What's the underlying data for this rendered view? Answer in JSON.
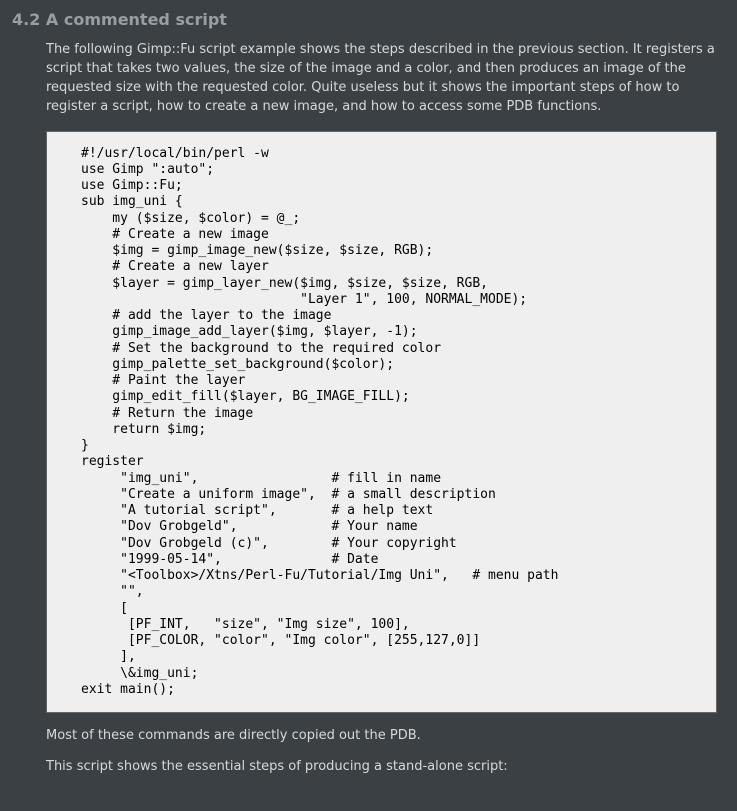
{
  "heading": "4.2 A commented script",
  "intro": "The following Gimp::Fu script example shows the steps described in the previous section. It registers a script that takes two values, the size of the image and a color, and then produces an image of the requested size with the requested color. Quite useless but it shows the important steps of how to register a script, how to create a new image, and how to access some PDB functions.",
  "code": "#!/usr/local/bin/perl -w\nuse Gimp \":auto\";\nuse Gimp::Fu;\nsub img_uni {\n    my ($size, $color) = @_;\n    # Create a new image\n    $img = gimp_image_new($size, $size, RGB);\n    # Create a new layer\n    $layer = gimp_layer_new($img, $size, $size, RGB,\n                            \"Layer 1\", 100, NORMAL_MODE);\n    # add the layer to the image\n    gimp_image_add_layer($img, $layer, -1);\n    # Set the background to the required color\n    gimp_palette_set_background($color);\n    # Paint the layer\n    gimp_edit_fill($layer, BG_IMAGE_FILL);\n    # Return the image\n    return $img;\n}\nregister\n     \"img_uni\",                 # fill in name\n     \"Create a uniform image\",  # a small description\n     \"A tutorial script\",       # a help text\n     \"Dov Grobgeld\",            # Your name\n     \"Dov Grobgeld (c)\",        # Your copyright\n     \"1999-05-14\",              # Date\n     \"<Toolbox>/Xtns/Perl-Fu/Tutorial/Img Uni\",   # menu path\n     \"\",\n     [\n      [PF_INT,   \"size\", \"Img size\", 100],\n      [PF_COLOR, \"color\", \"Img color\", [255,127,0]]\n     ],\n     \\&img_uni;\nexit main();",
  "after1": "Most of these commands are directly copied out the PDB.",
  "after2": "This script shows the essential steps of producing a stand-alone script:"
}
